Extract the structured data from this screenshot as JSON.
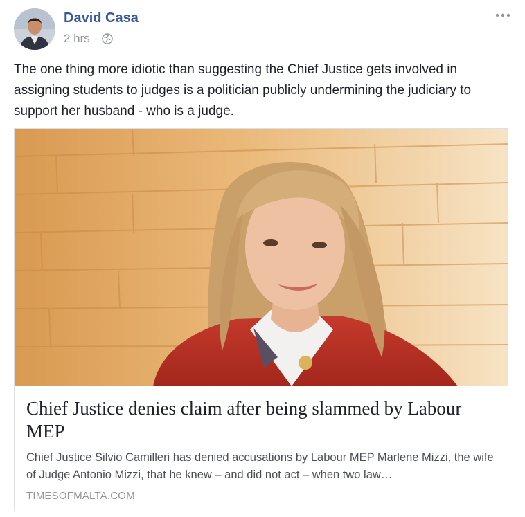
{
  "post": {
    "author": "David Casa",
    "time": "2 hrs",
    "separator": "·",
    "audience_icon": "globe-icon",
    "more_icon": "more-options-icon",
    "text": "The one thing more idiotic than suggesting the Chief Justice gets involved in assigning students to judges is a politician publicly undermining the judiciary to support her husband - who is a judge."
  },
  "link": {
    "title": "Chief Justice denies claim after being slammed by Labour MEP",
    "description": "Chief Justice Silvio Camilleri has denied accusations by Labour MEP Marlene Mizzi, the wife of Judge Antonio Mizzi, that he knew – and did not act – when two law…",
    "domain": "TIMESOFMALTA.COM"
  },
  "colors": {
    "author_link": "#365899",
    "meta_grey": "#90949c",
    "text": "#1d2129",
    "border": "#dddfe2"
  }
}
